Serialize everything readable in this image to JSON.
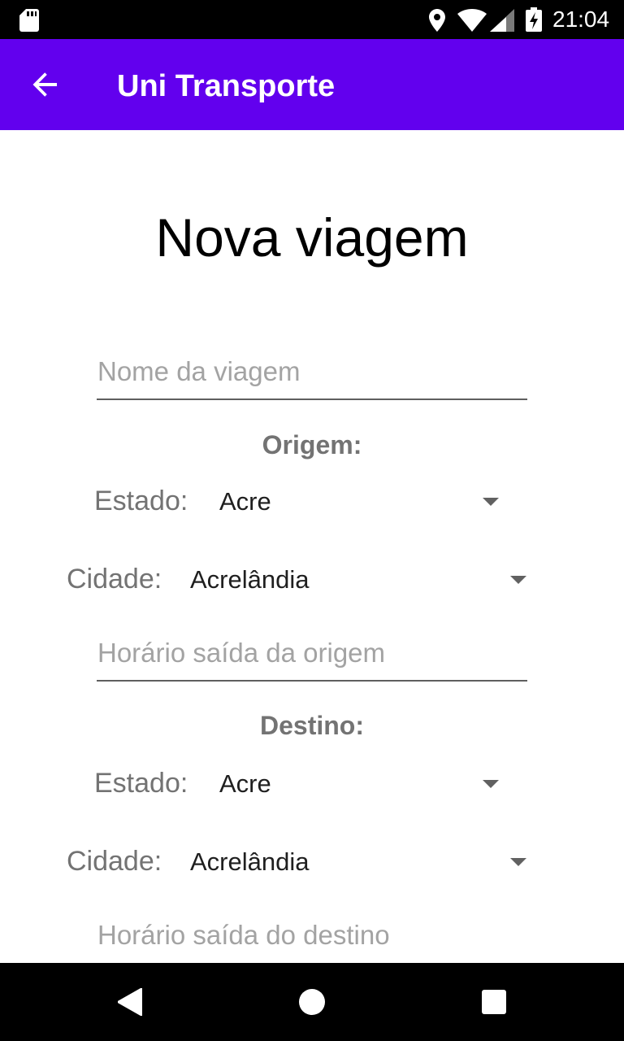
{
  "status_bar": {
    "time": "21:04",
    "icons": [
      "sd-card-icon",
      "location-icon",
      "wifi-icon",
      "signal-icon",
      "battery-charging-icon"
    ]
  },
  "app_bar": {
    "title": "Uni Transporte",
    "back_icon": "arrow-back-icon",
    "color": "#6200ee"
  },
  "form": {
    "title": "Nova viagem",
    "nome_placeholder": "Nome da viagem",
    "origem": {
      "section_label": "Origem:",
      "estado_label": "Estado:",
      "estado_value": "Acre",
      "cidade_label": "Cidade:",
      "cidade_value": "Acrelândia"
    },
    "horario_origem_placeholder": "Horário saída da origem",
    "destino": {
      "section_label": "Destino:",
      "estado_label": "Estado:",
      "estado_value": "Acre",
      "cidade_label": "Cidade:",
      "cidade_value": "Acrelândia"
    },
    "horario_destino_placeholder": "Horário saída do destino"
  },
  "nav_bar": {
    "icons": [
      "nav-back-icon",
      "nav-home-icon",
      "nav-recents-icon"
    ]
  }
}
